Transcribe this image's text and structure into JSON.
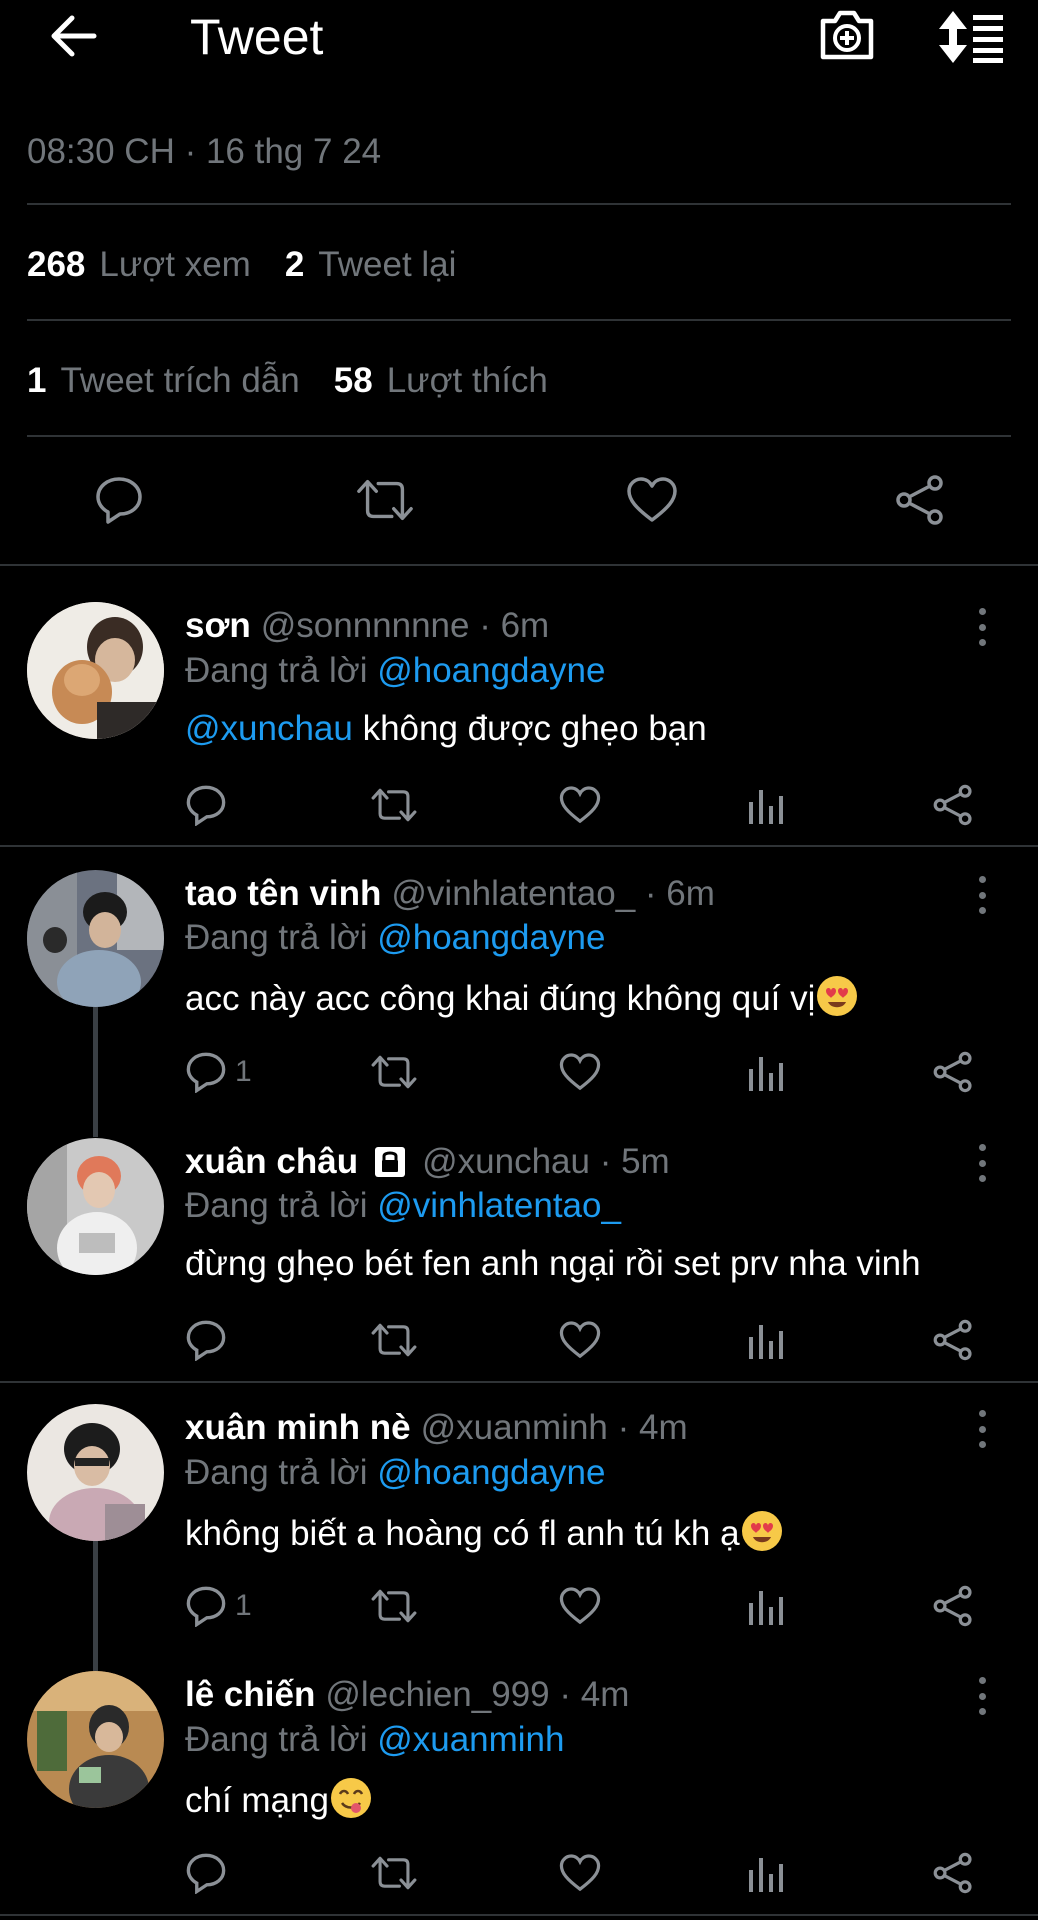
{
  "header": {
    "title": "Tweet",
    "back_icon": "arrow-left-icon",
    "camera_icon": "camera-plus-icon",
    "sort_icon": "sort-icon"
  },
  "tweet": {
    "timestamp": "08:30 CH · 16 thg 7 24",
    "views_count": "268",
    "views_label": "Lượt xem",
    "retweets_count": "2",
    "retweets_label": "Tweet lại",
    "quotes_count": "1",
    "quotes_label": "Tweet trích dẫn",
    "likes_count": "58",
    "likes_label": "Lượt thích"
  },
  "replying_prefix": "Đang trả lời",
  "replies": [
    {
      "name": "sơn",
      "handle": "@sonnnnnne · 6m",
      "replying_to": "@hoangdayne",
      "mention": "@xunchau",
      "text": " không được ghẹo bạn",
      "reply_count": ""
    },
    {
      "name": "tao tên vinh",
      "handle": "@vinhlatentao_ · 6m",
      "replying_to": "@hoangdayne",
      "mention": "",
      "text": "acc này acc công khai đúng không quí vị",
      "emoji": "heart-eyes-emoji",
      "reply_count": "1"
    },
    {
      "name": "xuân châu",
      "handle": "@xunchau · 5m",
      "replying_to": "@vinhlatentao_",
      "mention": "",
      "text": "đừng ghẹo bét fen anh ngại rồi set prv nha vinh",
      "locked": true,
      "reply_count": ""
    },
    {
      "name": "xuân minh nè",
      "handle": "@xuanminh · 4m",
      "replying_to": "@hoangdayne",
      "mention": "",
      "text": "không biết a hoàng có fl anh tú kh ạ",
      "emoji": "heart-eyes-emoji",
      "reply_count": "1"
    },
    {
      "name": "lê chiến",
      "handle": "@lechien_999 · 4m",
      "replying_to": "@xuanminh",
      "mention": "",
      "text": "chí mạng",
      "emoji": "yum-face-emoji",
      "reply_count": ""
    }
  ],
  "colors": {
    "background": "#000000",
    "text": "#ffffff",
    "muted": "#71767b",
    "link": "#1d9bf0",
    "divider": "#2f3336"
  }
}
